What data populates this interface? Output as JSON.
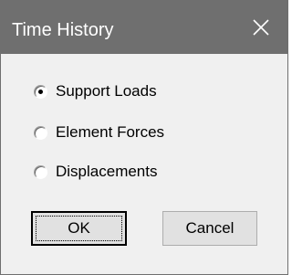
{
  "dialog": {
    "title": "Time History",
    "close_icon": "close-icon"
  },
  "options": [
    {
      "label": "Support Loads",
      "selected": true
    },
    {
      "label": "Element Forces",
      "selected": false
    },
    {
      "label": "Displacements",
      "selected": false
    }
  ],
  "buttons": {
    "ok_label": "OK",
    "cancel_label": "Cancel"
  },
  "colors": {
    "titlebar": "#6f6f6f",
    "title_text": "#ffffff",
    "client_bg": "#f0f0f0",
    "button_bg": "#e1e1e1"
  }
}
